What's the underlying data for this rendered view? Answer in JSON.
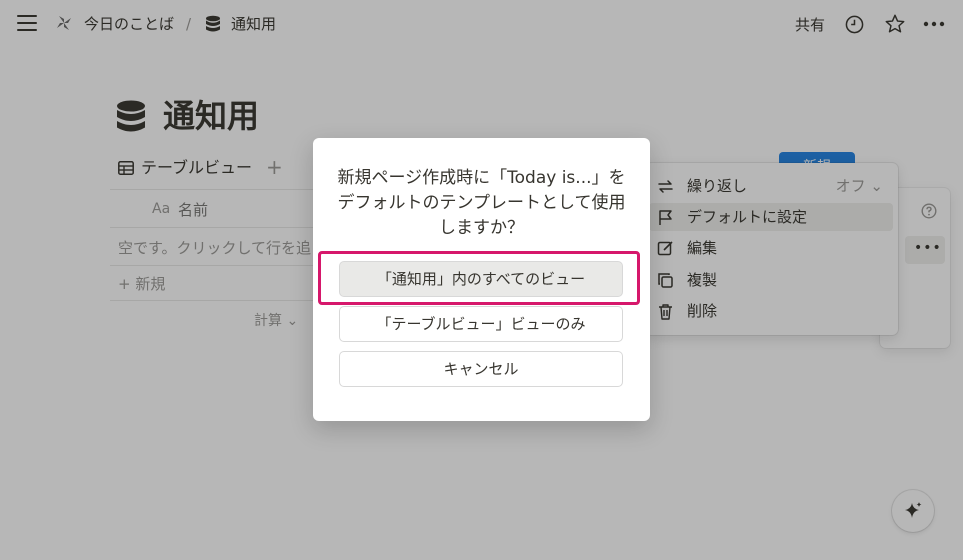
{
  "topbar": {
    "breadcrumb_parent": "今日のことば",
    "breadcrumb_sep": "/",
    "breadcrumb_current": "通知用",
    "share_label": "共有"
  },
  "page": {
    "title": "通知用"
  },
  "view": {
    "tab_label": "テーブルビュー",
    "add_label": "+",
    "col_type": "Aa",
    "col_name": "名前",
    "empty_text": "空です。クリックして行を追",
    "new_label": "+ 新規",
    "calc_label": "計算 ⌄",
    "new_button": "新規"
  },
  "context_menu": {
    "items": [
      {
        "label": "繰り返し",
        "value": "オフ ⌄",
        "icon": "repeat-icon"
      },
      {
        "label": "デフォルトに設定",
        "icon": "flag-icon"
      },
      {
        "label": "編集",
        "icon": "edit-icon"
      },
      {
        "label": "複製",
        "icon": "duplicate-icon"
      },
      {
        "label": "削除",
        "icon": "trash-icon"
      }
    ],
    "side_more": "•••"
  },
  "dialog": {
    "message": "新規ページ作成時に「Today is...」をデフォルトのテンプレートとして使用しますか？",
    "btn_all_views": "「通知用」内のすべてのビュー",
    "btn_this_view": "「テーブルビュー」ビューのみ",
    "btn_cancel": "キャンセル"
  },
  "colors": {
    "highlight": "#d6176b",
    "accent": "#2383e2"
  }
}
